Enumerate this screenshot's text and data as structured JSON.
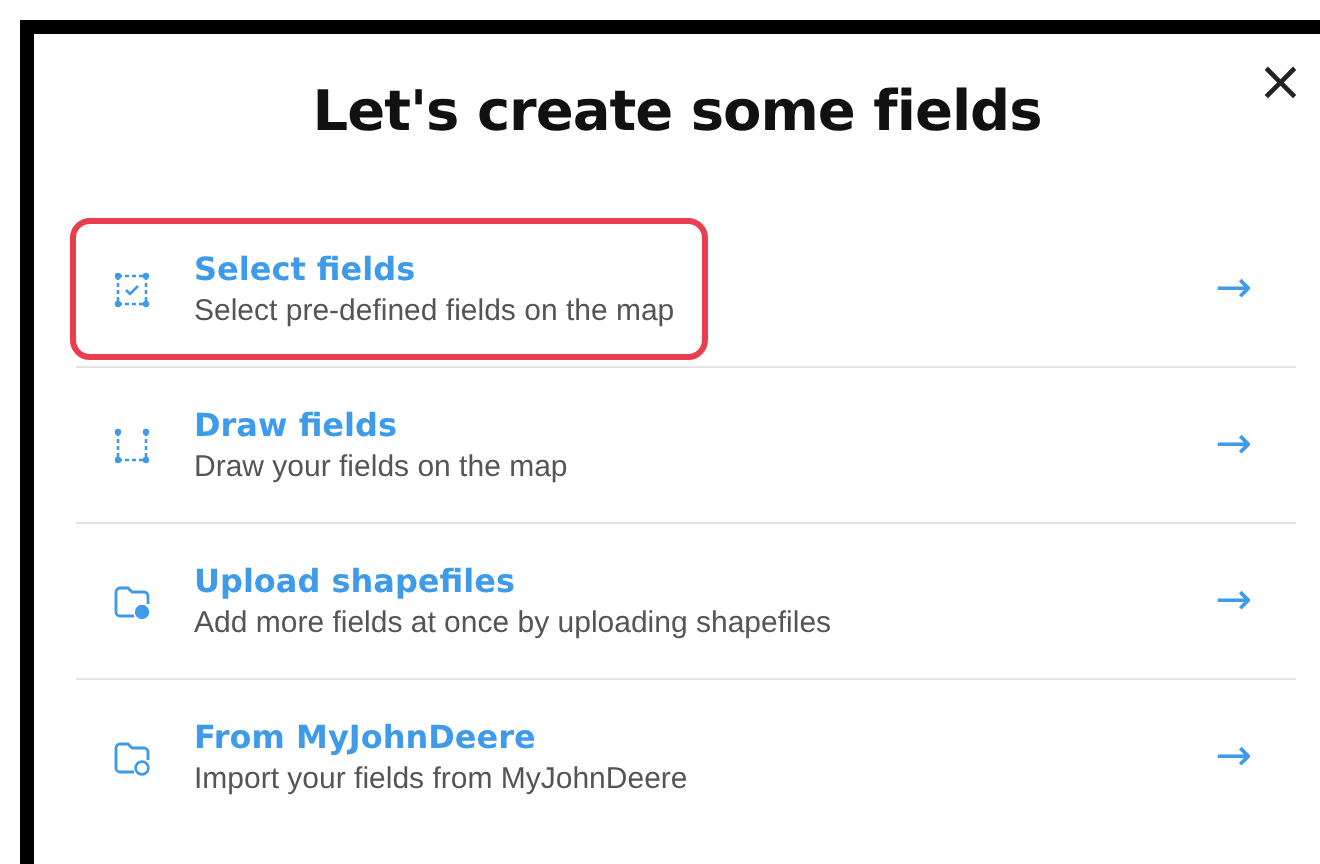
{
  "dialog": {
    "title": "Let's create some fields",
    "close": "×"
  },
  "options": [
    {
      "kind": "select",
      "title": "Select fields",
      "subtitle": "Select pre-defined fields on the map",
      "highlighted": true,
      "arrow": "→"
    },
    {
      "kind": "draw",
      "title": "Draw fields",
      "subtitle": "Draw your fields on the map",
      "highlighted": false,
      "arrow": "→"
    },
    {
      "kind": "upload",
      "title": "Upload shapefiles",
      "subtitle": "Add more fields at once by uploading shapefiles",
      "highlighted": false,
      "arrow": "→"
    },
    {
      "kind": "import",
      "title": "From MyJohnDeere",
      "subtitle": "Import your fields from MyJohnDeere",
      "highlighted": false,
      "arrow": "→"
    }
  ]
}
